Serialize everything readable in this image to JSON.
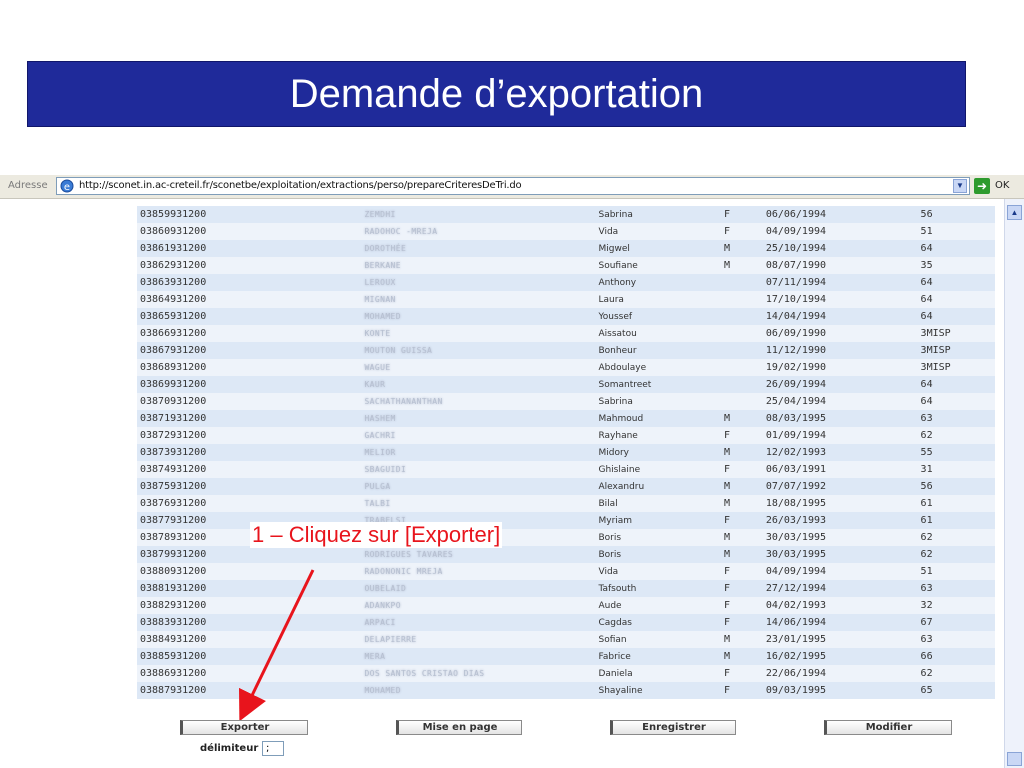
{
  "slide": {
    "title": "Demande d’exportation"
  },
  "browser": {
    "address_label": "Adresse",
    "url": "http://sconet.in.ac-creteil.fr/sconetbe/exploitation/extractions/perso/prepareCriteresDeTri.do",
    "go_label": "OK"
  },
  "annotation": {
    "text": "1 – Cliquez sur [Exporter]",
    "color": "#e8141c"
  },
  "colors": {
    "title_bg": "#1f2a9a",
    "row_odd": "#dde8f6",
    "row_even": "#eef3fa"
  },
  "table": {
    "rows": [
      {
        "id": "03859931200",
        "nom": "ZEMDHI",
        "prenom": "Sabrina",
        "sexe": "F",
        "date": "06/06/1994",
        "classe": "56"
      },
      {
        "id": "03860931200",
        "nom": "RADOHOC -MREJA",
        "prenom": "Vida",
        "sexe": "F",
        "date": "04/09/1994",
        "classe": "51"
      },
      {
        "id": "03861931200",
        "nom": "DOROTHÉE",
        "prenom": "Migwel",
        "sexe": "M",
        "date": "25/10/1994",
        "classe": "64"
      },
      {
        "id": "03862931200",
        "nom": "BERKANE",
        "prenom": "Soufiane",
        "sexe": "M",
        "date": "08/07/1990",
        "classe": "35"
      },
      {
        "id": "03863931200",
        "nom": "LEROUX",
        "prenom": "Anthony",
        "sexe": "",
        "date": "07/11/1994",
        "classe": "64"
      },
      {
        "id": "03864931200",
        "nom": "MIGNAN",
        "prenom": "Laura",
        "sexe": "",
        "date": "17/10/1994",
        "classe": "64"
      },
      {
        "id": "03865931200",
        "nom": "MOHAMED",
        "prenom": "Youssef",
        "sexe": "",
        "date": "14/04/1994",
        "classe": "64"
      },
      {
        "id": "03866931200",
        "nom": "KONTE",
        "prenom": "Aissatou",
        "sexe": "",
        "date": "06/09/1990",
        "classe": "3MISP"
      },
      {
        "id": "03867931200",
        "nom": "MOUTON GUISSA",
        "prenom": "Bonheur",
        "sexe": "",
        "date": "11/12/1990",
        "classe": "3MISP"
      },
      {
        "id": "03868931200",
        "nom": "WAGUE",
        "prenom": "Abdoulaye",
        "sexe": "",
        "date": "19/02/1990",
        "classe": "3MISP"
      },
      {
        "id": "03869931200",
        "nom": "KAUR",
        "prenom": "Somantreet",
        "sexe": "",
        "date": "26/09/1994",
        "classe": "64"
      },
      {
        "id": "03870931200",
        "nom": "SACHATHANANTHAN",
        "prenom": "Sabrina",
        "sexe": "",
        "date": "25/04/1994",
        "classe": "64"
      },
      {
        "id": "03871931200",
        "nom": "HASHEM",
        "prenom": "Mahmoud",
        "sexe": "M",
        "date": "08/03/1995",
        "classe": "63"
      },
      {
        "id": "03872931200",
        "nom": "GACHRI",
        "prenom": "Rayhane",
        "sexe": "F",
        "date": "01/09/1994",
        "classe": "62"
      },
      {
        "id": "03873931200",
        "nom": "MELIOR",
        "prenom": "Midory",
        "sexe": "M",
        "date": "12/02/1993",
        "classe": "55"
      },
      {
        "id": "03874931200",
        "nom": "SBAGUIDI",
        "prenom": "Ghislaine",
        "sexe": "F",
        "date": "06/03/1991",
        "classe": "31"
      },
      {
        "id": "03875931200",
        "nom": "PULGA",
        "prenom": "Alexandru",
        "sexe": "M",
        "date": "07/07/1992",
        "classe": "56"
      },
      {
        "id": "03876931200",
        "nom": "TALBI",
        "prenom": "Bilal",
        "sexe": "M",
        "date": "18/08/1995",
        "classe": "61"
      },
      {
        "id": "03877931200",
        "nom": "TRABELSI",
        "prenom": "Myriam",
        "sexe": "F",
        "date": "26/03/1993",
        "classe": "61"
      },
      {
        "id": "03878931200",
        "nom": "",
        "prenom": "Boris",
        "sexe": "M",
        "date": "30/03/1995",
        "classe": "62"
      },
      {
        "id": "03879931200",
        "nom": "RODRIGUES TAVARES",
        "prenom": "Boris",
        "sexe": "M",
        "date": "30/03/1995",
        "classe": "62"
      },
      {
        "id": "03880931200",
        "nom": "RADONONIC MREJA",
        "prenom": "Vida",
        "sexe": "F",
        "date": "04/09/1994",
        "classe": "51"
      },
      {
        "id": "03881931200",
        "nom": "OUBELAID",
        "prenom": "Tafsouth",
        "sexe": "F",
        "date": "27/12/1994",
        "classe": "63"
      },
      {
        "id": "03882931200",
        "nom": "ADANKPO",
        "prenom": "Aude",
        "sexe": "F",
        "date": "04/02/1993",
        "classe": "32"
      },
      {
        "id": "03883931200",
        "nom": "ARPACI",
        "prenom": "Cagdas",
        "sexe": "F",
        "date": "14/06/1994",
        "classe": "67"
      },
      {
        "id": "03884931200",
        "nom": "DELAPIERRE",
        "prenom": "Sofian",
        "sexe": "M",
        "date": "23/01/1995",
        "classe": "63"
      },
      {
        "id": "03885931200",
        "nom": "MERA",
        "prenom": "Fabrice",
        "sexe": "M",
        "date": "16/02/1995",
        "classe": "66"
      },
      {
        "id": "03886931200",
        "nom": "DOS SANTOS CRISTAO DIAS",
        "prenom": "Daniela",
        "sexe": "F",
        "date": "22/06/1994",
        "classe": "62"
      },
      {
        "id": "03887931200",
        "nom": "MOHAMED",
        "prenom": "Shayaline",
        "sexe": "F",
        "date": "09/03/1995",
        "classe": "65"
      }
    ]
  },
  "buttons": {
    "exporter": "Exporter",
    "mise_en_page": "Mise en page",
    "enregistrer": "Enregistrer",
    "modifier": "Modifier"
  },
  "delimiter": {
    "label": "délimiteur",
    "value": ";"
  }
}
